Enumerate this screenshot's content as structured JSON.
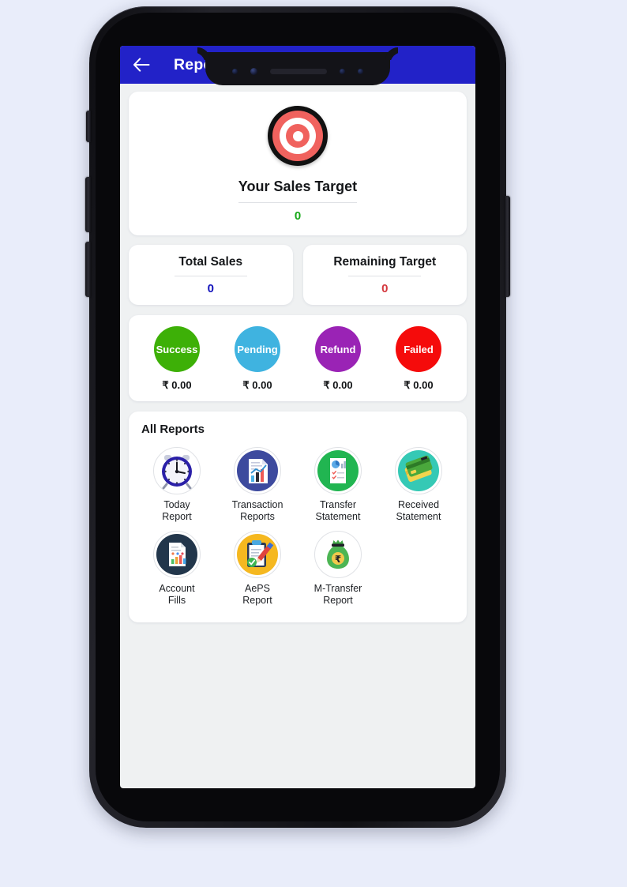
{
  "appbar": {
    "back_icon": "arrow-left-icon",
    "title": "Reports",
    "bg_color": "#2222c8"
  },
  "sales_target": {
    "icon": "bullseye-target-icon",
    "title": "Your Sales Target",
    "value": "0",
    "value_color": "#17a818"
  },
  "summary": [
    {
      "title": "Total Sales",
      "value": "0",
      "value_color": "#1111bb"
    },
    {
      "title": "Remaining Target",
      "value": "0",
      "value_color": "#d4393f"
    }
  ],
  "status": [
    {
      "label": "Success",
      "amount": "₹ 0.00",
      "color": "#3db007"
    },
    {
      "label": "Pending",
      "amount": "₹ 0.00",
      "color": "#3fb3e0"
    },
    {
      "label": "Refund",
      "amount": "₹ 0.00",
      "color": "#9a23b5"
    },
    {
      "label": "Failed",
      "amount": "₹ 0.00",
      "color": "#f50b0b"
    }
  ],
  "all_reports": {
    "section_title": "All Reports",
    "items": [
      {
        "label": "Today\nReport",
        "icon": "alarm-clock-icon"
      },
      {
        "label": "Transaction\nReports",
        "icon": "chart-document-icon"
      },
      {
        "label": "Transfer\nStatement",
        "icon": "green-report-document-icon"
      },
      {
        "label": "Received\nStatement",
        "icon": "credit-cards-icon"
      },
      {
        "label": "Account\nFills",
        "icon": "bar-chart-document-icon"
      },
      {
        "label": "AePS\nReport",
        "icon": "clipboard-pen-icon"
      },
      {
        "label": "M-Transfer\nReport",
        "icon": "money-bag-rupee-icon"
      }
    ]
  },
  "theme": {
    "page_bg": "#e9edfa",
    "screen_bg": "#eff1f2",
    "card_bg": "#ffffff"
  }
}
